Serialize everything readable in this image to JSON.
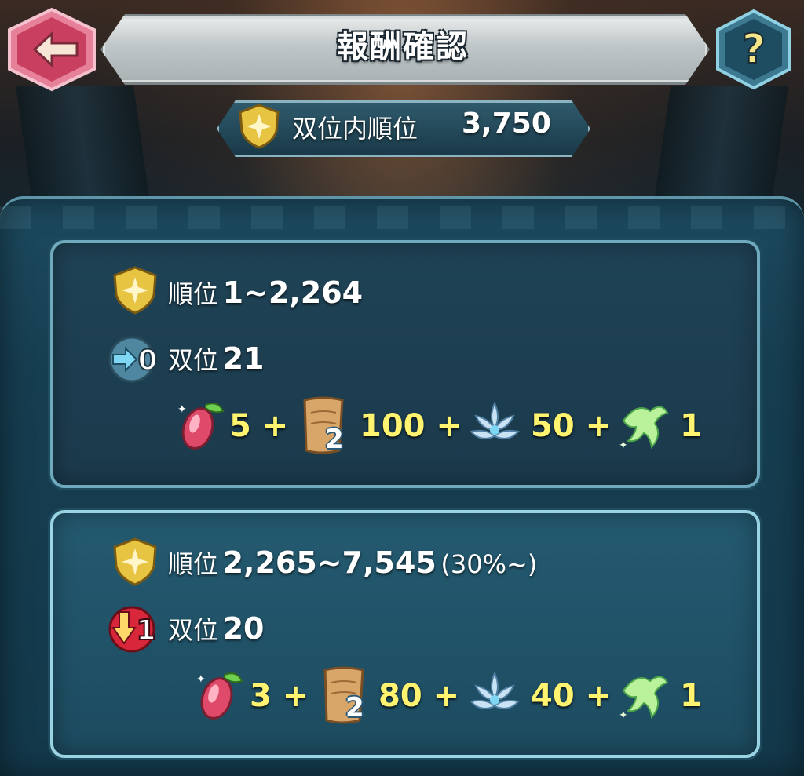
{
  "header": {
    "title": "報酬確認",
    "back_icon": "arrow-left-icon",
    "help_icon": "question-mark-icon"
  },
  "score": {
    "label": "双位内順位",
    "value": "3,750"
  },
  "tiers": [
    {
      "rank_label": "順位",
      "rank_range": "1~2,264",
      "rank_note": "",
      "tier_change_icon": "arrow-right-0-icon",
      "tier_badge_value": "0",
      "tier_label": "双位",
      "tier_value": "21",
      "rewards": [
        {
          "icon": "divine-fruit-icon",
          "amount": "5",
          "sep": "+"
        },
        {
          "icon": "scroll-icon",
          "tag": "2",
          "amount": "100",
          "sep": "+"
        },
        {
          "icon": "lotus-flower-icon",
          "amount": "50",
          "sep": "+"
        },
        {
          "icon": "green-phoenix-icon",
          "amount": "1",
          "sep": ""
        }
      ]
    },
    {
      "rank_label": "順位",
      "rank_range": "2,265~7,545",
      "rank_note": "(30%~)",
      "tier_change_icon": "arrow-down-1-icon",
      "tier_badge_value": "1",
      "tier_label": "双位",
      "tier_value": "20",
      "rewards": [
        {
          "icon": "divine-fruit-icon",
          "amount": "3",
          "sep": "+"
        },
        {
          "icon": "scroll-icon",
          "tag": "2",
          "amount": "80",
          "sep": "+"
        },
        {
          "icon": "lotus-flower-icon",
          "amount": "40",
          "sep": "+"
        },
        {
          "icon": "green-phoenix-icon",
          "amount": "1",
          "sep": ""
        }
      ]
    }
  ],
  "colors": {
    "reward_number": "#fff36f",
    "panel_border": "#6fa9bd",
    "panel_border_active": "#9ad3e3"
  }
}
